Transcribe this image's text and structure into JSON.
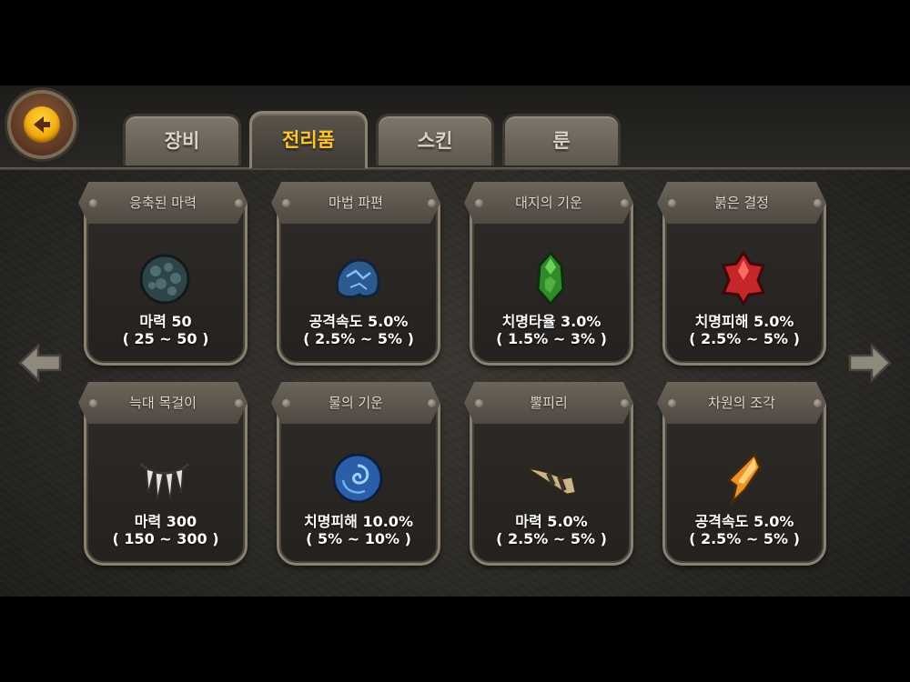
{
  "tabs": [
    {
      "label": "장비",
      "active": false
    },
    {
      "label": "전리품",
      "active": true
    },
    {
      "label": "스킨",
      "active": false
    },
    {
      "label": "룬",
      "active": false
    }
  ],
  "accent_color": "#ffc529",
  "cards": [
    {
      "title": "응축된 마력",
      "icon": "dark-stone-icon",
      "stat": "마력 50",
      "range": "( 25 ~ 50 )"
    },
    {
      "title": "마법 파편",
      "icon": "blue-rock-fragment-icon",
      "stat": "공격속도 5.0%",
      "range": "( 2.5% ~ 5% )"
    },
    {
      "title": "대지의 기운",
      "icon": "green-crystal-icon",
      "stat": "치명타율 3.0%",
      "range": "( 1.5% ~ 3% )"
    },
    {
      "title": "붉은 결정",
      "icon": "red-crystal-icon",
      "stat": "치명피해 5.0%",
      "range": "( 2.5% ~ 5% )"
    },
    {
      "title": "늑대 목걸이",
      "icon": "fang-necklace-icon",
      "stat": "마력 300",
      "range": "( 150 ~ 300 )"
    },
    {
      "title": "물의 기운",
      "icon": "water-orb-icon",
      "stat": "치명피해 10.0%",
      "range": "( 5% ~ 10% )"
    },
    {
      "title": "뿔피리",
      "icon": "horn-icon",
      "stat": "마력 5.0%",
      "range": "( 2.5% ~ 5% )"
    },
    {
      "title": "차원의 조각",
      "icon": "orange-shard-icon",
      "stat": "공격속도 5.0%",
      "range": "( 2.5% ~ 5% )"
    }
  ]
}
